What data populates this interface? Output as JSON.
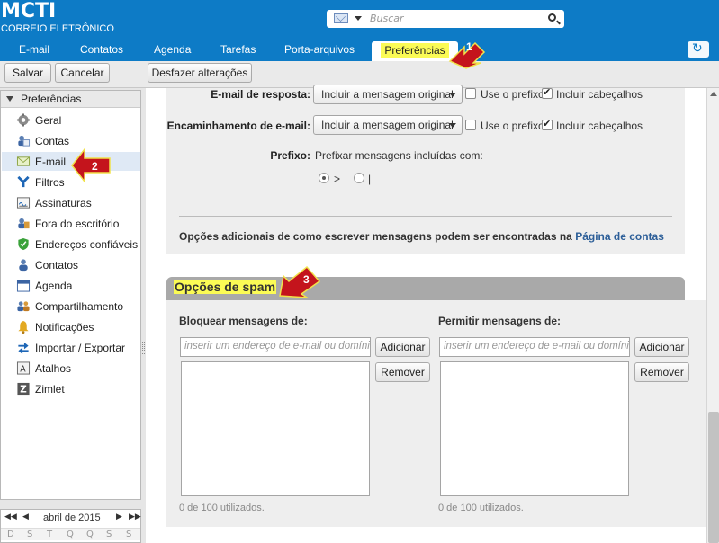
{
  "app": {
    "logo_title": "MCTI",
    "logo_subtitle": "CORREIO ELETRÔNICO",
    "search_placeholder": "Buscar"
  },
  "nav": {
    "tabs": [
      {
        "label": "E-mail"
      },
      {
        "label": "Contatos"
      },
      {
        "label": "Agenda"
      },
      {
        "label": "Tarefas"
      },
      {
        "label": "Porta-arquivos"
      },
      {
        "label": "Preferências",
        "active": true
      }
    ],
    "refresh_icon": "refresh-icon"
  },
  "toolbar": {
    "save": "Salvar",
    "cancel": "Cancelar",
    "undo": "Desfazer alterações"
  },
  "sidebar": {
    "header": "Preferências",
    "items": [
      {
        "label": "Geral",
        "icon": "gear-icon"
      },
      {
        "label": "Contas",
        "icon": "accounts-icon"
      },
      {
        "label": "E-mail",
        "icon": "envelope-icon",
        "selected": true
      },
      {
        "label": "Filtros",
        "icon": "filter-icon"
      },
      {
        "label": "Assinaturas",
        "icon": "signature-icon"
      },
      {
        "label": "Fora do escritório",
        "icon": "out-of-office-icon"
      },
      {
        "label": "Endereços confiáveis",
        "icon": "shield-icon"
      },
      {
        "label": "Contatos",
        "icon": "contact-icon"
      },
      {
        "label": "Agenda",
        "icon": "calendar-icon"
      },
      {
        "label": "Compartilhamento",
        "icon": "share-icon"
      },
      {
        "label": "Notificações",
        "icon": "bell-icon"
      },
      {
        "label": "Importar / Exportar",
        "icon": "import-export-icon"
      },
      {
        "label": "Atalhos",
        "icon": "shortcut-icon"
      },
      {
        "label": "Zimlet",
        "icon": "zimlet-icon"
      }
    ]
  },
  "calendar": {
    "month": "abril de 2015",
    "prev_year": "◀◀",
    "prev_month": "◀",
    "next_month": "▶",
    "next_year": "▶▶",
    "weekdays": [
      "D",
      "S",
      "T",
      "Q",
      "Q",
      "S",
      "S"
    ]
  },
  "compose": {
    "reply_label": "E-mail de resposta:",
    "reply_value": "Incluir a mensagem original",
    "forward_label": "Encaminhamento de e-mail:",
    "forward_value": "Incluir a mensagem original",
    "use_prefix": "Use o prefixo",
    "include_headers": "Incluir cabeçalhos",
    "prefix_label": "Prefixo:",
    "prefix_text": "Prefixar mensagens incluídas com:",
    "prefix_opt1": ">",
    "prefix_opt2": "|",
    "note_text": "Opções adicionais de como escrever mensagens podem ser encontradas na ",
    "note_link": "Página de contas"
  },
  "spam": {
    "title": "Opções de spam",
    "block_label": "Bloquear mensagens de:",
    "allow_label": "Permitir mensagens de:",
    "input_placeholder": "inserir um endereço de e-mail ou domínio",
    "add": "Adicionar",
    "remove": "Remover",
    "usage": "0 de 100 utilizados."
  },
  "callouts": [
    "1",
    "2",
    "3"
  ],
  "colors": {
    "header_blue": "#0d7bc6",
    "highlight_yellow": "#fbfb55",
    "callout_red": "#c4141c"
  }
}
